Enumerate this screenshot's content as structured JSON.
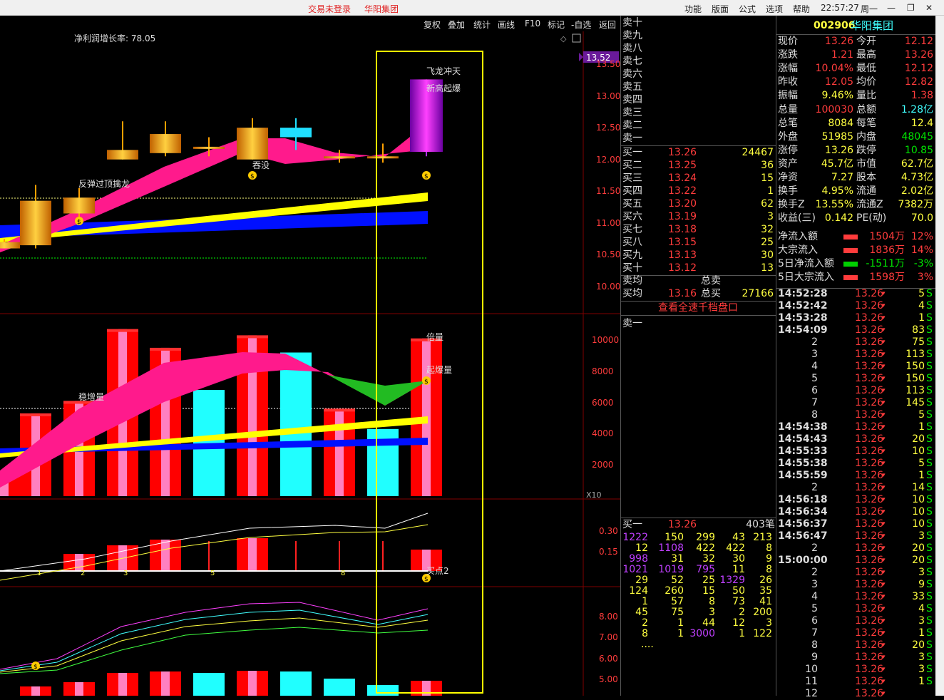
{
  "topbar": {
    "status": "交易未登录",
    "stock": "华阳集团",
    "menu": [
      "功能",
      "版面",
      "公式",
      "选项",
      "帮助"
    ],
    "time": "22:57:27",
    "weekday": "周一"
  },
  "toolbar": [
    "复权",
    "叠加",
    "统计",
    "画线",
    "F10",
    "标记",
    "-自选",
    "返回"
  ],
  "chart": {
    "header": "净利润增长率: 78.05",
    "price_label": "13.52",
    "price_ticks": [
      "13.50",
      "13.00",
      "12.50",
      "12.00",
      "11.50",
      "11.00",
      "10.50",
      "10.00"
    ],
    "vol_ticks": [
      "10000",
      "8000",
      "6000",
      "4000",
      "2000"
    ],
    "vol_unit": "X10",
    "ind1_ticks": [
      "0.30",
      "0.15"
    ],
    "ind2_ticks": [
      "8.00",
      "7.00",
      "6.00",
      "5.00"
    ],
    "labels": {
      "rebound": "反弹过顶擒龙",
      "tunmo": "吞没",
      "flying": "飞龙冲天",
      "new_high": "新高起爆",
      "stable_vol": "稳增量",
      "double_vol": "倍量",
      "burst_vol": "起爆量",
      "buy_point": "买点2"
    },
    "ind1_nums": [
      "1",
      "2",
      "3",
      "5",
      "8"
    ],
    "candles": [
      {
        "o": 10.6,
        "c": 10.7,
        "h": 10.75,
        "l": 10.6
      },
      {
        "o": 10.65,
        "c": 11.35,
        "h": 11.6,
        "l": 10.6
      },
      {
        "o": 11.15,
        "c": 11.4,
        "h": 11.55,
        "l": 11.0
      },
      {
        "o": 12.0,
        "c": 12.15,
        "h": 12.6,
        "l": 12.0
      },
      {
        "o": 12.1,
        "c": 12.4,
        "h": 12.6,
        "l": 12.05
      },
      {
        "o": 12.2,
        "c": 12.2,
        "h": 12.35,
        "l": 12.05
      },
      {
        "o": 12.0,
        "c": 12.5,
        "h": 12.65,
        "l": 12.0
      },
      {
        "o": 12.5,
        "c": 12.35,
        "h": 12.65,
        "l": 12.15
      },
      {
        "o": 12.05,
        "c": 12.05,
        "h": 12.15,
        "l": 11.95
      },
      {
        "o": 12.05,
        "c": 12.05,
        "h": 12.25,
        "l": 11.95
      },
      {
        "o": 12.12,
        "c": 13.26,
        "h": 13.26,
        "l": 12.05
      }
    ],
    "volumes": [
      1600,
      5300,
      6100,
      10700,
      9500,
      6800,
      10300,
      9200,
      5600,
      4300,
      10100
    ]
  },
  "quote": {
    "sell": [
      "卖十",
      "卖九",
      "卖八",
      "卖七",
      "卖六",
      "卖五",
      "卖四",
      "卖三",
      "卖二",
      "卖一"
    ],
    "buy": [
      [
        "买一",
        "13.26",
        "24467"
      ],
      [
        "买二",
        "13.25",
        "36"
      ],
      [
        "买三",
        "13.24",
        "15"
      ],
      [
        "买四",
        "13.22",
        "1"
      ],
      [
        "买五",
        "13.20",
        "62"
      ],
      [
        "买六",
        "13.19",
        "3"
      ],
      [
        "买七",
        "13.18",
        "32"
      ],
      [
        "买八",
        "13.15",
        "25"
      ],
      [
        "买九",
        "13.13",
        "30"
      ],
      [
        "买十",
        "13.12",
        "13"
      ]
    ],
    "avg_sell": "卖均",
    "total_sell": "总卖",
    "avg_buy": "买均",
    "avg_buy_val": "13.16",
    "total_buy": "总买",
    "total_buy_val": "27166",
    "link": "查看全速千档盘口",
    "sell1": "卖一",
    "queue_head": [
      "买一",
      "13.26",
      "403笔"
    ],
    "queue": [
      [
        "1222",
        "150",
        "299",
        "43",
        "213"
      ],
      [
        "12",
        "1108",
        "422",
        "422",
        "8"
      ],
      [
        "998",
        "31",
        "32",
        "30",
        "9"
      ],
      [
        "1021",
        "1019",
        "795",
        "11",
        "8"
      ],
      [
        "29",
        "52",
        "25",
        "1329",
        "26"
      ],
      [
        "124",
        "260",
        "15",
        "50",
        "35"
      ],
      [
        "1",
        "57",
        "8",
        "73",
        "41"
      ],
      [
        "45",
        "75",
        "3",
        "2",
        "200"
      ],
      [
        "2",
        "1",
        "44",
        "12",
        "3"
      ],
      [
        "8",
        "1",
        "3000",
        "1",
        "122"
      ]
    ],
    "queue_more": "...."
  },
  "info": {
    "code": "002906",
    "name": "华阳集团",
    "rows": [
      [
        "现价",
        "13.26",
        "今开",
        "12.12"
      ],
      [
        "涨跌",
        "1.21",
        "最高",
        "13.26"
      ],
      [
        "涨幅",
        "10.04%",
        "最低",
        "12.12"
      ],
      [
        "昨收",
        "12.05",
        "均价",
        "12.82"
      ],
      [
        "振幅",
        "9.46%",
        "量比",
        "1.38"
      ],
      [
        "总量",
        "100030",
        "总额",
        "1.28亿"
      ],
      [
        "总笔",
        "8084",
        "每笔",
        "12.4"
      ],
      [
        "外盘",
        "51985",
        "内盘",
        "48045"
      ],
      [
        "涨停",
        "13.26",
        "跌停",
        "10.85"
      ],
      [
        "资产",
        "45.7亿",
        "市值",
        "62.7亿"
      ],
      [
        "净资",
        "7.27",
        "股本",
        "4.73亿"
      ],
      [
        "换手",
        "4.95%",
        "流通",
        "2.02亿"
      ],
      [
        "换手Z",
        "13.55%",
        "流通Z",
        "7382万"
      ],
      [
        "收益(三)",
        "0.142",
        "PE(动)",
        "70.0"
      ]
    ],
    "flows": [
      [
        "净流入额",
        "1504万",
        "12%"
      ],
      [
        "大宗流入",
        "1836万",
        "14%"
      ],
      [
        "5日净流入额",
        "-1511万",
        "-3%"
      ],
      [
        "5日大宗流入",
        "1598万",
        "3%"
      ]
    ],
    "ticks": [
      [
        "14:52:28",
        "13.26",
        "5"
      ],
      [
        "14:52:42",
        "13.26",
        "4"
      ],
      [
        "14:53:28",
        "13.26",
        "1"
      ],
      [
        "14:54:09",
        "13.26",
        "83"
      ],
      [
        "2",
        "13.26",
        "75"
      ],
      [
        "3",
        "13.26",
        "113"
      ],
      [
        "4",
        "13.26",
        "150"
      ],
      [
        "5",
        "13.26",
        "150"
      ],
      [
        "6",
        "13.26",
        "113"
      ],
      [
        "7",
        "13.26",
        "145"
      ],
      [
        "8",
        "13.26",
        "5"
      ],
      [
        "14:54:38",
        "13.26",
        "1"
      ],
      [
        "14:54:43",
        "13.26",
        "20"
      ],
      [
        "14:55:33",
        "13.26",
        "10"
      ],
      [
        "14:55:38",
        "13.26",
        "5"
      ],
      [
        "14:55:59",
        "13.26",
        "1"
      ],
      [
        "2",
        "13.26",
        "14"
      ],
      [
        "14:56:18",
        "13.26",
        "10"
      ],
      [
        "14:56:34",
        "13.26",
        "10"
      ],
      [
        "14:56:37",
        "13.26",
        "10"
      ],
      [
        "14:56:47",
        "13.26",
        "3"
      ],
      [
        "2",
        "13.26",
        "20"
      ],
      [
        "15:00:00",
        "13.26",
        "20"
      ],
      [
        "2",
        "13.26",
        "3"
      ],
      [
        "3",
        "13.26",
        "9"
      ],
      [
        "4",
        "13.26",
        "33"
      ],
      [
        "5",
        "13.26",
        "4"
      ],
      [
        "6",
        "13.26",
        "3"
      ],
      [
        "7",
        "13.26",
        "1"
      ],
      [
        "8",
        "13.26",
        "20"
      ],
      [
        "9",
        "13.26",
        "3"
      ],
      [
        "10",
        "13.26",
        "3"
      ],
      [
        "11",
        "13.26",
        "1"
      ],
      [
        "12",
        "13.26",
        ""
      ]
    ],
    "tick_flag": "S"
  }
}
